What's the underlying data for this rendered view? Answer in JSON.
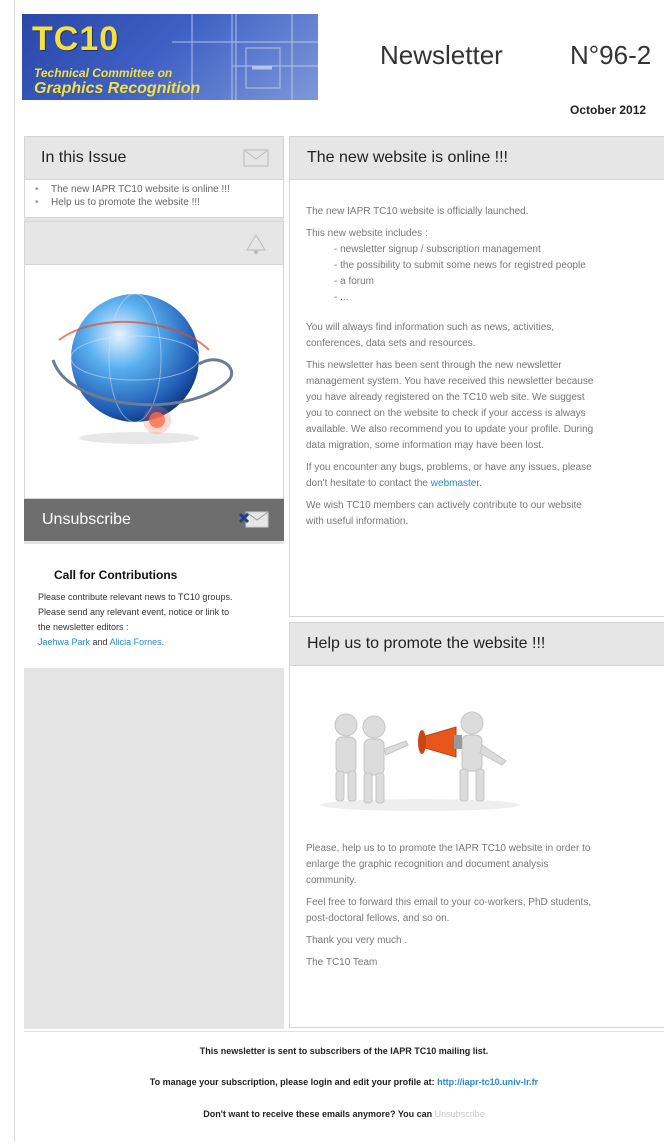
{
  "header": {
    "logo_title": "TC10",
    "logo_line1": "Technical Committee on",
    "logo_line2": "Graphics Recognition",
    "title": "Newsletter",
    "issue_number": "N°96-2",
    "date": "October 2012"
  },
  "sidebar": {
    "in_this_issue_title": "In this Issue",
    "issue_items": [
      "The new IAPR TC10 website is online !!!",
      "Help us to promote the website !!!"
    ],
    "unsubscribe_label": "Unsubscribe",
    "call_title": "Call for Contributions",
    "call_lines": [
      "Please contribute relevant news to TC10 groups.",
      "Please send any relevant event, notice or link to",
      "the newsletter editors :"
    ],
    "editor1": "Jaehwa Park",
    "and_text": " and ",
    "editor2": "Alicia Fornes",
    "period": "."
  },
  "article1": {
    "title": "The new website is online !!!",
    "p1": "The new IAPR TC10 website is officially launched.",
    "p2": "This new website includes :",
    "bullets": [
      "- newsletter signup /  subscription management",
      "- the possibility to submit some news for registred people",
      "- a forum",
      "- ..."
    ],
    "p3_lines": [
      "You will always find information such as news, activities,",
      "conferences, data sets and resources."
    ],
    "p4_lines": [
      "This newsletter has been sent through the new newsletter",
      "management system. You have received this newsletter because",
      "you have already registered on the TC10 web site. We suggest",
      "you to connect on the website to check if your access is always",
      "available. We also recommend you to update your profile. During",
      "data migration, some information may have been lost."
    ],
    "p5_line1": "If you encounter any bugs, problems, or have any issues, please",
    "p5_line2_prefix": "don't hesitate to contact the ",
    "p5_link": "webmaster",
    "p5_suffix": ".",
    "p6_lines": [
      "We wish TC10 members can actively contribute to our website",
      "with useful information."
    ]
  },
  "article2": {
    "title": "Help us to promote the website !!!",
    "p1_lines": [
      "Please, help us to to promote the IAPR TC10 website in order to",
      "enlarge the graphic recognition and document analysis",
      "community."
    ],
    "p2_lines": [
      "Feel free to forward this email to your co-workers, PhD students,",
      "post-doctoral fellows, and so on."
    ],
    "p3": "Thank you very much .",
    "p4": "The TC10 Team"
  },
  "footer": {
    "line1": "This newsletter is sent to subscribers of the IAPR TC10 mailing list.",
    "line2_prefix": "To manage your subscription, please login and edit your profile at: ",
    "line2_link": "http://iapr-tc10.univ-lr.fr",
    "line3_prefix": "Don't want to receive these emails anymore? You can ",
    "line3_link": "Unsubscribe"
  },
  "colors": {
    "link": "#2a89c6",
    "logo_yellow": "#f5e13a",
    "logo_blue": "#2a47a8",
    "unsubscribe_bar": "#6e6e6e"
  },
  "icons": [
    "envelope-icon",
    "bell-icon",
    "unsubscribe-envelope-icon",
    "globe-image",
    "megaphone-people-image"
  ]
}
